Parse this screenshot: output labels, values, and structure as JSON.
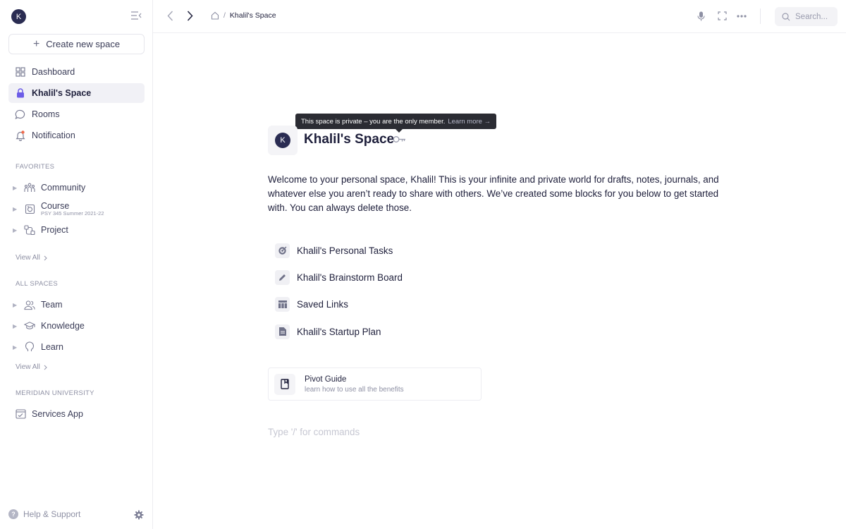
{
  "sidebar": {
    "avatar_initial": "K",
    "create_label": "Create new space",
    "nav": [
      {
        "label": "Dashboard",
        "icon": "dashboard-grid-icon"
      },
      {
        "label": "Khalil's Space",
        "icon": "lock-icon",
        "active": true
      },
      {
        "label": "Rooms",
        "icon": "chat-bubble-icon"
      },
      {
        "label": "Notification",
        "icon": "bell-icon"
      }
    ],
    "favorites": {
      "title": "FAVORITES",
      "items": [
        {
          "label": "Community",
          "icon": "community-icon"
        },
        {
          "label": "Course",
          "sub": "PSY 345 Summer 2021-22",
          "icon": "course-icon"
        },
        {
          "label": "Project",
          "icon": "project-icon"
        }
      ],
      "view_all": "View All"
    },
    "all_spaces": {
      "title": "ALL SPACES",
      "items": [
        {
          "label": "Team",
          "icon": "team-icon"
        },
        {
          "label": "Knowledge",
          "icon": "graduation-cap-icon"
        },
        {
          "label": "Learn",
          "icon": "lightbulb-icon"
        }
      ],
      "view_all": "View All"
    },
    "org": {
      "title": "MERIDIAN UNIVERSITY",
      "app_label": "Services App"
    },
    "help_label": "Help & Support"
  },
  "topbar": {
    "breadcrumb_sep": "/",
    "breadcrumb_current": "Khalil's Space",
    "search_placeholder": "Search..."
  },
  "main": {
    "tooltip_text": "This space is private – you are the only member.",
    "tooltip_link": "Learn more →",
    "avatar_initial": "K",
    "title": "Khalil's Space",
    "welcome": "Welcome to your personal space, Khalil! This is your infinite and private world for drafts, notes, journals, and whatever else you aren’t ready to share with others. We’ve created some blocks for you below to get started with. You can always delete those.",
    "blocks": [
      {
        "label": "Khalil's Personal Tasks",
        "icon": "target-icon"
      },
      {
        "label": "Khalil's Brainstorm Board",
        "icon": "pencil-icon"
      },
      {
        "label": "Saved Links",
        "icon": "table-icon"
      },
      {
        "label": "Khalil's Startup Plan",
        "icon": "document-icon"
      }
    ],
    "guide": {
      "title": "Pivot Guide",
      "subtitle": "learn how to use all the benefits"
    },
    "command_placeholder": "Type '/' for commands"
  },
  "colors": {
    "accent": "#2a2c52",
    "active_bg": "#f1f1f6",
    "notification_dot": "#ef6b4c",
    "tooltip_bg": "#2b2c33"
  }
}
